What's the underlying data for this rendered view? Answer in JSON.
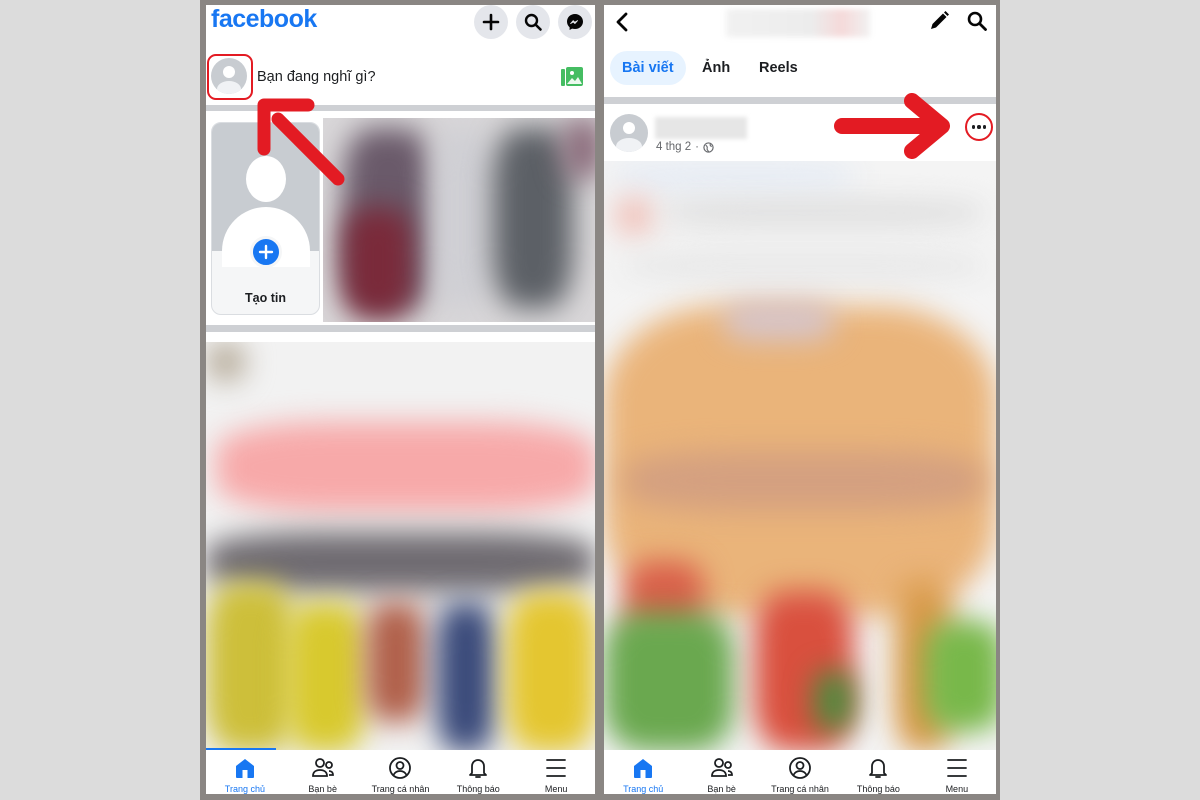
{
  "left_screen": {
    "header": {
      "logo": "facebook",
      "buttons": [
        {
          "name": "create",
          "icon": "plus-icon"
        },
        {
          "name": "search",
          "icon": "search-icon"
        },
        {
          "name": "messenger",
          "icon": "messenger-icon"
        }
      ]
    },
    "composer": {
      "placeholder": "Bạn đang nghĩ gì?",
      "photo_icon": "photo-icon"
    },
    "stories": {
      "create_label": "Tạo tin"
    },
    "bottom_nav": [
      {
        "label": "Trang chủ",
        "icon": "home-icon",
        "active": true
      },
      {
        "label": "Bạn bè",
        "icon": "friends-icon",
        "active": false
      },
      {
        "label": "Trang cá nhân",
        "icon": "profile-icon",
        "active": false
      },
      {
        "label": "Thông báo",
        "icon": "bell-icon",
        "active": false
      },
      {
        "label": "Menu",
        "icon": "menu-icon",
        "active": false
      }
    ]
  },
  "right_screen": {
    "header": {
      "back_icon": "chevron-left-icon",
      "edit_icon": "pencil-icon",
      "search_icon": "search-icon"
    },
    "tabs": [
      {
        "label": "Bài viết",
        "active": true
      },
      {
        "label": "Ảnh",
        "active": false
      },
      {
        "label": "Reels",
        "active": false
      }
    ],
    "post": {
      "time": "4 thg 2",
      "separator": "·",
      "privacy_icon": "globe-icon",
      "more_icon": "more-horizontal-icon"
    },
    "bottom_nav": [
      {
        "label": "Trang chủ",
        "icon": "home-icon",
        "active": true
      },
      {
        "label": "Bạn bè",
        "icon": "friends-icon",
        "active": false
      },
      {
        "label": "Trang cá nhân",
        "icon": "profile-icon",
        "active": false
      },
      {
        "label": "Thông báo",
        "icon": "bell-icon",
        "active": false
      },
      {
        "label": "Menu",
        "icon": "menu-icon",
        "active": false
      }
    ]
  },
  "annotations": {
    "color": "#e31b23",
    "arrows": [
      "pointing to composer avatar",
      "pointing to post more options button"
    ]
  },
  "colors": {
    "brand": "#1877f2",
    "annotation": "#e31b23",
    "photo_icon": "#45bd62"
  }
}
